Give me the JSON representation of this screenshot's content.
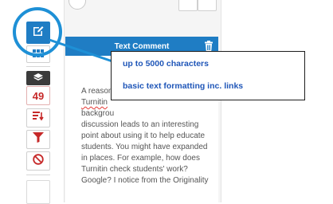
{
  "panel": {
    "header_title": "Text Comment",
    "comment_lines": [
      "A reasona",
      "Turnitin",
      "backgrou",
      "discussion leads to an interesting",
      "point about using it to help educate",
      "students. You might have expanded",
      "in places. For example, how does",
      "Turnitin check students' work?",
      "Google? I notice from the Originality"
    ]
  },
  "toolbar": {
    "score_count": "49"
  },
  "callout": {
    "line1": "up to 5000 characters",
    "line2": "basic text formatting inc. links"
  },
  "colors": {
    "accent_blue": "#1f7dc4",
    "highlight_ring": "#1e90d6",
    "icon_red": "#c62828",
    "callout_text": "#1f56b8"
  },
  "icons": [
    "edit-icon",
    "grid-icon",
    "layers-icon",
    "sort-icon",
    "filter-icon",
    "no-entry-icon",
    "delete-icon"
  ]
}
